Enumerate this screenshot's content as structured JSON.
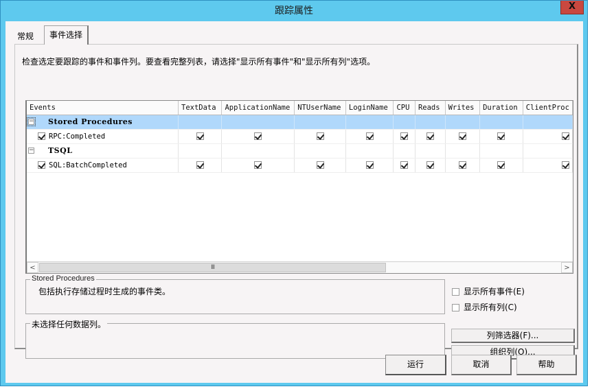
{
  "window": {
    "title": "跟踪属性",
    "close_label": "X"
  },
  "tabs": [
    {
      "label": "常规",
      "active": false
    },
    {
      "label": "事件选择",
      "active": true
    }
  ],
  "instruction": "检查选定要跟踪的事件和事件列。要查看完整列表，请选择\"显示所有事件\"和\"显示所有列\"选项。",
  "grid": {
    "columns": [
      "Events",
      "TextData",
      "ApplicationName",
      "NTUserName",
      "LoginName",
      "CPU",
      "Reads",
      "Writes",
      "Duration",
      "ClientProc"
    ],
    "rows": [
      {
        "type": "category",
        "label": "Stored Procedures",
        "expander": "−",
        "selected": true
      },
      {
        "type": "event",
        "label": "RPC:Completed",
        "checked": true,
        "cells": [
          true,
          true,
          true,
          true,
          true,
          true,
          true,
          true,
          true
        ]
      },
      {
        "type": "category",
        "label": "TSQL",
        "expander": "−",
        "selected": false
      },
      {
        "type": "event",
        "label": "SQL:BatchCompleted",
        "checked": true,
        "cells": [
          true,
          true,
          true,
          true,
          true,
          true,
          true,
          true,
          true
        ]
      }
    ],
    "scroll_left": "<",
    "scroll_right": ">",
    "scroll_grip": "III"
  },
  "description_group": {
    "title": "Stored Procedures",
    "text": "包括执行存储过程时生成的事件类。"
  },
  "columns_group": {
    "title": "未选择任何数据列。"
  },
  "options": {
    "show_all_events": {
      "label": "显示所有事件(E)",
      "checked": false
    },
    "show_all_columns": {
      "label": "显示所有列(C)",
      "checked": false
    }
  },
  "buttons": {
    "column_filters": "列筛选器(F)...",
    "organize_columns": "组织列(O)...",
    "run": "运行",
    "cancel": "取消",
    "help": "帮助"
  },
  "colors": {
    "titlebar": "#5ec9ee",
    "close_button": "#c9483f",
    "selected_row": "#b0d8fb",
    "client_background": "#f7f4f5"
  }
}
